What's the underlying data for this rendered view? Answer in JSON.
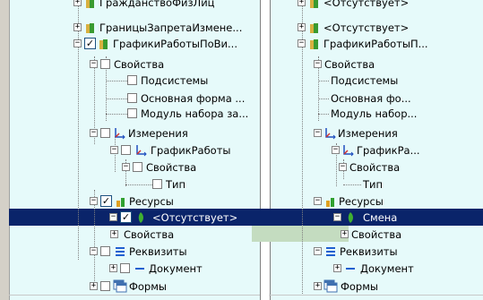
{
  "left_tree": {
    "rows": [
      {
        "label": "ГражданствоФизЛиц"
      },
      {
        "label": "ГраницыЗапретаИзмене..."
      },
      {
        "label": "ГрафикиРаботыПоВи..."
      },
      {
        "label": "Свойства"
      },
      {
        "label": "Подсистемы"
      },
      {
        "label": "Основная форма ..."
      },
      {
        "label": "Модуль набора за..."
      },
      {
        "label": "Измерения"
      },
      {
        "label": "ГрафикРаботы"
      },
      {
        "label": "Свойства"
      },
      {
        "label": "Тип"
      },
      {
        "label": "Ресурсы"
      },
      {
        "label": "<Отсутствует>"
      },
      {
        "label": "Свойства"
      },
      {
        "label": "Реквизиты"
      },
      {
        "label": "Документ"
      },
      {
        "label": "Формы"
      }
    ]
  },
  "right_tree": {
    "rows": [
      {
        "label": "<Отсутствует>"
      },
      {
        "label": "<Отсутствует>"
      },
      {
        "label": "ГрафикиРаботыП..."
      },
      {
        "label": "Свойства"
      },
      {
        "label": "Подсистемы"
      },
      {
        "label": "Основная фо..."
      },
      {
        "label": "Модуль набор..."
      },
      {
        "label": "Измерения"
      },
      {
        "label": "ГрафикРа..."
      },
      {
        "label": "Свойства"
      },
      {
        "label": "Тип"
      },
      {
        "label": "Ресурсы"
      },
      {
        "label": "Смена"
      },
      {
        "label": "Свойства"
      },
      {
        "label": "Реквизиты"
      },
      {
        "label": "Документ"
      },
      {
        "label": "Формы"
      }
    ]
  },
  "colors": {
    "row_tint": "#e6fafa",
    "selection": "#0a246a",
    "diff_green": "#c4dcc0",
    "divider": "#808080"
  }
}
